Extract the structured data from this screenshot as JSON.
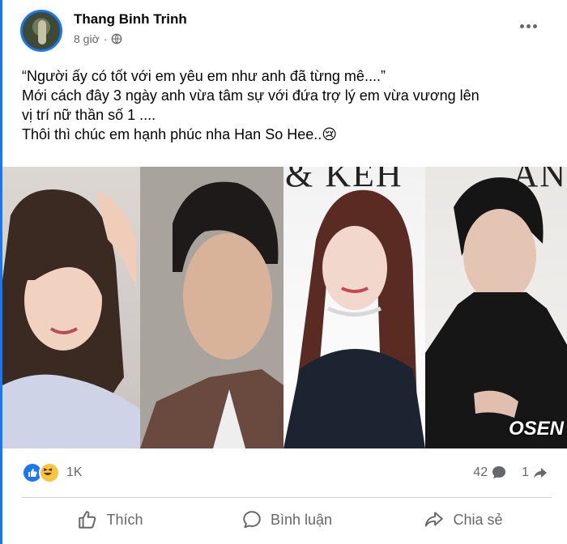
{
  "post": {
    "author": "Thang Binh Trinh",
    "time": "8 giờ",
    "separator": "·",
    "privacy_icon": "globe-icon",
    "lines": [
      "“Người ấy có tốt với em yêu em như anh đã từng mê....”",
      "Mới cách đây 3 ngày anh vừa tâm sự với đứa trợ lý em vừa vương lên",
      "vị trí nữ thần số 1 ....",
      "Thôi thì chúc em hạnh phúc nha Han So Hee..😢"
    ],
    "photo_overlays": {
      "brand_a": "& KEH",
      "brand_b": "AN",
      "watermark": "OSEN"
    }
  },
  "stats": {
    "reaction_icons": [
      "like-icon",
      "haha-icon"
    ],
    "reaction_count": "1K",
    "comment_count": "42",
    "share_count": "1"
  },
  "actions": {
    "like_label": "Thích",
    "comment_label": "Bình luận",
    "share_label": "Chia sẻ"
  },
  "colors": {
    "accent": "#1877f2",
    "text": "#050505",
    "muted": "#65676b"
  }
}
